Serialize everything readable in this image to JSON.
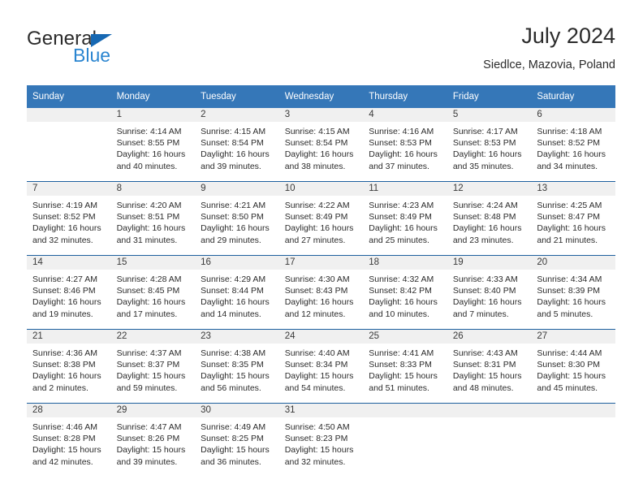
{
  "brand": {
    "name_dark": "General",
    "name_blue": "Blue",
    "triangle_color": "#1668b3",
    "blue_color": "#2a85d0"
  },
  "header": {
    "title": "July 2024",
    "subtitle": "Siedlce, Mazovia, Poland"
  },
  "theme": {
    "header_bg": "#3577b8",
    "row_divider": "#1d5f9e",
    "daynum_bg": "#f0f0f0",
    "text": "#2b2b2b"
  },
  "weekday_headers": [
    "Sunday",
    "Monday",
    "Tuesday",
    "Wednesday",
    "Thursday",
    "Friday",
    "Saturday"
  ],
  "weeks": [
    [
      {
        "day": "",
        "sunrise": "",
        "sunset": "",
        "daylight1": "",
        "daylight2": "",
        "empty": true
      },
      {
        "day": "1",
        "sunrise": "Sunrise: 4:14 AM",
        "sunset": "Sunset: 8:55 PM",
        "daylight1": "Daylight: 16 hours",
        "daylight2": "and 40 minutes.",
        "empty": false
      },
      {
        "day": "2",
        "sunrise": "Sunrise: 4:15 AM",
        "sunset": "Sunset: 8:54 PM",
        "daylight1": "Daylight: 16 hours",
        "daylight2": "and 39 minutes.",
        "empty": false
      },
      {
        "day": "3",
        "sunrise": "Sunrise: 4:15 AM",
        "sunset": "Sunset: 8:54 PM",
        "daylight1": "Daylight: 16 hours",
        "daylight2": "and 38 minutes.",
        "empty": false
      },
      {
        "day": "4",
        "sunrise": "Sunrise: 4:16 AM",
        "sunset": "Sunset: 8:53 PM",
        "daylight1": "Daylight: 16 hours",
        "daylight2": "and 37 minutes.",
        "empty": false
      },
      {
        "day": "5",
        "sunrise": "Sunrise: 4:17 AM",
        "sunset": "Sunset: 8:53 PM",
        "daylight1": "Daylight: 16 hours",
        "daylight2": "and 35 minutes.",
        "empty": false
      },
      {
        "day": "6",
        "sunrise": "Sunrise: 4:18 AM",
        "sunset": "Sunset: 8:52 PM",
        "daylight1": "Daylight: 16 hours",
        "daylight2": "and 34 minutes.",
        "empty": false
      }
    ],
    [
      {
        "day": "7",
        "sunrise": "Sunrise: 4:19 AM",
        "sunset": "Sunset: 8:52 PM",
        "daylight1": "Daylight: 16 hours",
        "daylight2": "and 32 minutes.",
        "empty": false
      },
      {
        "day": "8",
        "sunrise": "Sunrise: 4:20 AM",
        "sunset": "Sunset: 8:51 PM",
        "daylight1": "Daylight: 16 hours",
        "daylight2": "and 31 minutes.",
        "empty": false
      },
      {
        "day": "9",
        "sunrise": "Sunrise: 4:21 AM",
        "sunset": "Sunset: 8:50 PM",
        "daylight1": "Daylight: 16 hours",
        "daylight2": "and 29 minutes.",
        "empty": false
      },
      {
        "day": "10",
        "sunrise": "Sunrise: 4:22 AM",
        "sunset": "Sunset: 8:49 PM",
        "daylight1": "Daylight: 16 hours",
        "daylight2": "and 27 minutes.",
        "empty": false
      },
      {
        "day": "11",
        "sunrise": "Sunrise: 4:23 AM",
        "sunset": "Sunset: 8:49 PM",
        "daylight1": "Daylight: 16 hours",
        "daylight2": "and 25 minutes.",
        "empty": false
      },
      {
        "day": "12",
        "sunrise": "Sunrise: 4:24 AM",
        "sunset": "Sunset: 8:48 PM",
        "daylight1": "Daylight: 16 hours",
        "daylight2": "and 23 minutes.",
        "empty": false
      },
      {
        "day": "13",
        "sunrise": "Sunrise: 4:25 AM",
        "sunset": "Sunset: 8:47 PM",
        "daylight1": "Daylight: 16 hours",
        "daylight2": "and 21 minutes.",
        "empty": false
      }
    ],
    [
      {
        "day": "14",
        "sunrise": "Sunrise: 4:27 AM",
        "sunset": "Sunset: 8:46 PM",
        "daylight1": "Daylight: 16 hours",
        "daylight2": "and 19 minutes.",
        "empty": false
      },
      {
        "day": "15",
        "sunrise": "Sunrise: 4:28 AM",
        "sunset": "Sunset: 8:45 PM",
        "daylight1": "Daylight: 16 hours",
        "daylight2": "and 17 minutes.",
        "empty": false
      },
      {
        "day": "16",
        "sunrise": "Sunrise: 4:29 AM",
        "sunset": "Sunset: 8:44 PM",
        "daylight1": "Daylight: 16 hours",
        "daylight2": "and 14 minutes.",
        "empty": false
      },
      {
        "day": "17",
        "sunrise": "Sunrise: 4:30 AM",
        "sunset": "Sunset: 8:43 PM",
        "daylight1": "Daylight: 16 hours",
        "daylight2": "and 12 minutes.",
        "empty": false
      },
      {
        "day": "18",
        "sunrise": "Sunrise: 4:32 AM",
        "sunset": "Sunset: 8:42 PM",
        "daylight1": "Daylight: 16 hours",
        "daylight2": "and 10 minutes.",
        "empty": false
      },
      {
        "day": "19",
        "sunrise": "Sunrise: 4:33 AM",
        "sunset": "Sunset: 8:40 PM",
        "daylight1": "Daylight: 16 hours",
        "daylight2": "and 7 minutes.",
        "empty": false
      },
      {
        "day": "20",
        "sunrise": "Sunrise: 4:34 AM",
        "sunset": "Sunset: 8:39 PM",
        "daylight1": "Daylight: 16 hours",
        "daylight2": "and 5 minutes.",
        "empty": false
      }
    ],
    [
      {
        "day": "21",
        "sunrise": "Sunrise: 4:36 AM",
        "sunset": "Sunset: 8:38 PM",
        "daylight1": "Daylight: 16 hours",
        "daylight2": "and 2 minutes.",
        "empty": false
      },
      {
        "day": "22",
        "sunrise": "Sunrise: 4:37 AM",
        "sunset": "Sunset: 8:37 PM",
        "daylight1": "Daylight: 15 hours",
        "daylight2": "and 59 minutes.",
        "empty": false
      },
      {
        "day": "23",
        "sunrise": "Sunrise: 4:38 AM",
        "sunset": "Sunset: 8:35 PM",
        "daylight1": "Daylight: 15 hours",
        "daylight2": "and 56 minutes.",
        "empty": false
      },
      {
        "day": "24",
        "sunrise": "Sunrise: 4:40 AM",
        "sunset": "Sunset: 8:34 PM",
        "daylight1": "Daylight: 15 hours",
        "daylight2": "and 54 minutes.",
        "empty": false
      },
      {
        "day": "25",
        "sunrise": "Sunrise: 4:41 AM",
        "sunset": "Sunset: 8:33 PM",
        "daylight1": "Daylight: 15 hours",
        "daylight2": "and 51 minutes.",
        "empty": false
      },
      {
        "day": "26",
        "sunrise": "Sunrise: 4:43 AM",
        "sunset": "Sunset: 8:31 PM",
        "daylight1": "Daylight: 15 hours",
        "daylight2": "and 48 minutes.",
        "empty": false
      },
      {
        "day": "27",
        "sunrise": "Sunrise: 4:44 AM",
        "sunset": "Sunset: 8:30 PM",
        "daylight1": "Daylight: 15 hours",
        "daylight2": "and 45 minutes.",
        "empty": false
      }
    ],
    [
      {
        "day": "28",
        "sunrise": "Sunrise: 4:46 AM",
        "sunset": "Sunset: 8:28 PM",
        "daylight1": "Daylight: 15 hours",
        "daylight2": "and 42 minutes.",
        "empty": false
      },
      {
        "day": "29",
        "sunrise": "Sunrise: 4:47 AM",
        "sunset": "Sunset: 8:26 PM",
        "daylight1": "Daylight: 15 hours",
        "daylight2": "and 39 minutes.",
        "empty": false
      },
      {
        "day": "30",
        "sunrise": "Sunrise: 4:49 AM",
        "sunset": "Sunset: 8:25 PM",
        "daylight1": "Daylight: 15 hours",
        "daylight2": "and 36 minutes.",
        "empty": false
      },
      {
        "day": "31",
        "sunrise": "Sunrise: 4:50 AM",
        "sunset": "Sunset: 8:23 PM",
        "daylight1": "Daylight: 15 hours",
        "daylight2": "and 32 minutes.",
        "empty": false
      },
      {
        "day": "",
        "sunrise": "",
        "sunset": "",
        "daylight1": "",
        "daylight2": "",
        "empty": true
      },
      {
        "day": "",
        "sunrise": "",
        "sunset": "",
        "daylight1": "",
        "daylight2": "",
        "empty": true
      },
      {
        "day": "",
        "sunrise": "",
        "sunset": "",
        "daylight1": "",
        "daylight2": "",
        "empty": true
      }
    ]
  ]
}
